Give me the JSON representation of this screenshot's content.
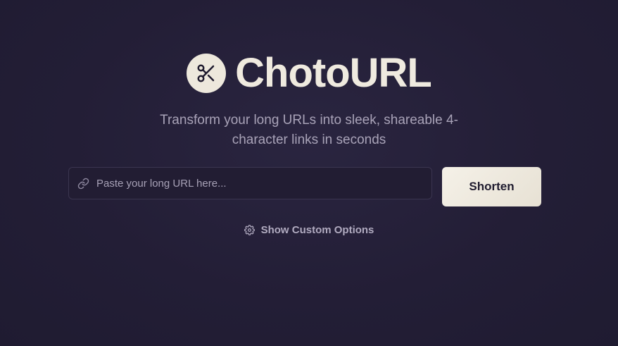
{
  "brand": {
    "logo_icon": "scissors-icon",
    "title": "ChotoURL"
  },
  "hero": {
    "subtitle_line1": "Transform your long URLs into sleek, shareable 4-",
    "subtitle_line2": "character links in seconds"
  },
  "form": {
    "url_input": {
      "icon": "link-icon",
      "value": "",
      "placeholder": "Paste your long URL here..."
    },
    "submit_label": "Shorten"
  },
  "options": {
    "icon": "gear-icon",
    "label": "Show Custom Options"
  },
  "colors": {
    "background": "#231e36",
    "accent": "#ede8dc",
    "text_muted": "#a9a3b8"
  }
}
